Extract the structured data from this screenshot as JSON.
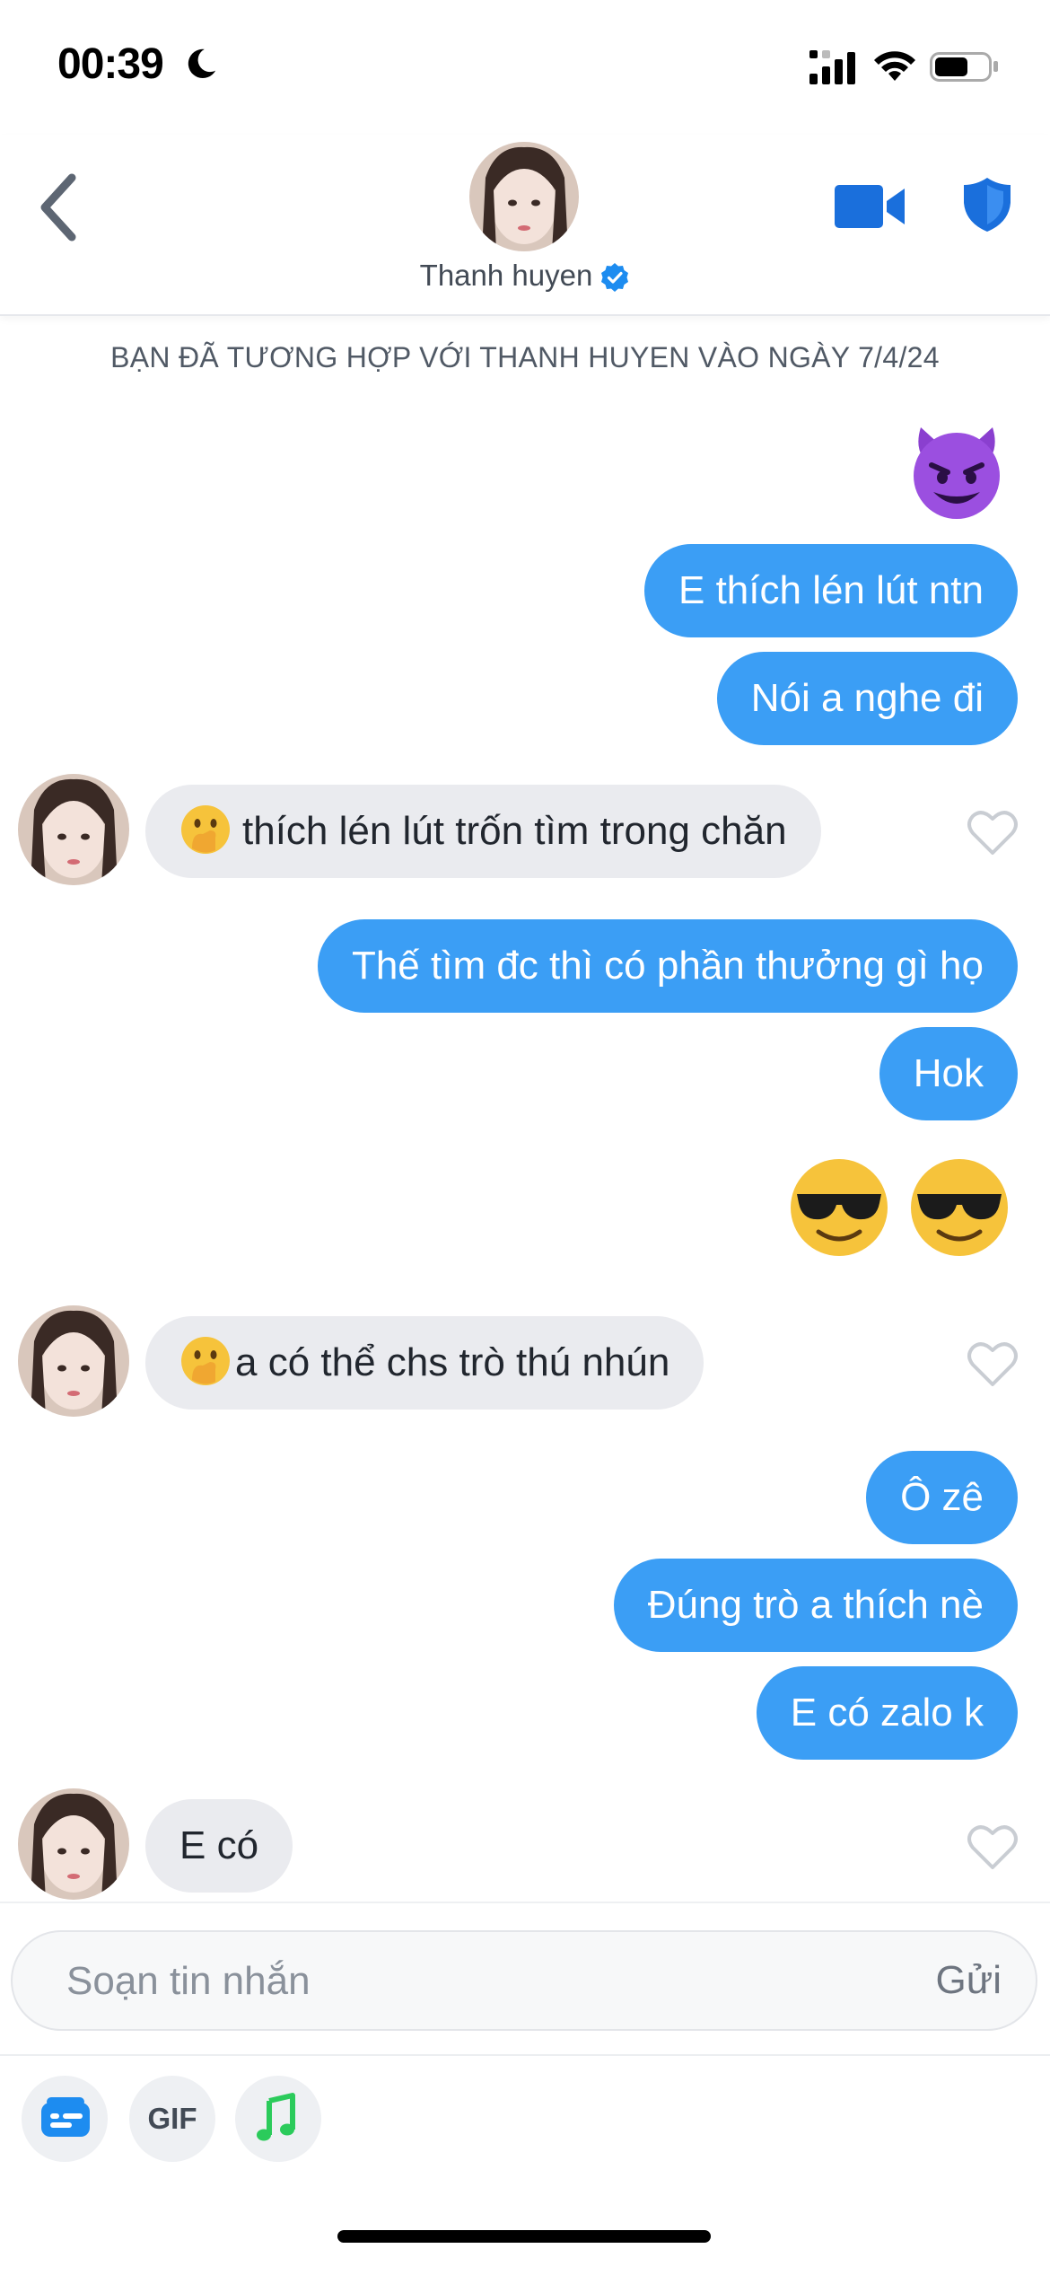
{
  "status_bar": {
    "time": "00:39",
    "battery_level": 0.62
  },
  "header": {
    "name": "Thanh huyen",
    "verified": true
  },
  "match_notice": "BẠN ĐÃ TƯƠNG HỢP VỚI THANH HUYEN VÀO NGÀY 7/4/24",
  "messages": {
    "m1_emoji": "😈",
    "m2": "E thích lén lút ntn",
    "m3": "Nói a nghe đi",
    "m4": "thích lén lút trốn tìm trong chăn",
    "m5": "Thế tìm đc thì có phần thưởng gì họ",
    "m6": "Hok",
    "m7_emoji": "😎 😎",
    "m8": "a có thể chs trò thú nhún",
    "m9": "Ô zê",
    "m10": "Đúng trò a thích nè",
    "m11": "E có zalo k",
    "m12": "E có"
  },
  "composer": {
    "placeholder": "Soạn tin nhắn",
    "send_label": "Gửi",
    "gif_label": "GIF"
  },
  "colors": {
    "sent_bubble": "#3b9ef5",
    "received_bubble": "#eaebef",
    "accent_blue": "#1a73e8",
    "music_green": "#2bcb5b"
  }
}
